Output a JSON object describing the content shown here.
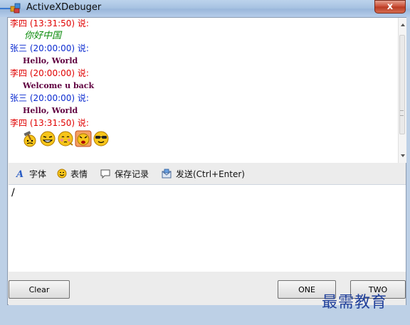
{
  "window": {
    "title": "ActiveXDebuger",
    "close_label": "x"
  },
  "messages": [
    {
      "header": "李四 (13:31:50) 说:",
      "header_color": "red",
      "body": "你好中国",
      "body_style": "green-italic"
    },
    {
      "header": "张三 (20:00:00) 说:",
      "header_color": "blue",
      "body": "Hello, World",
      "body_style": "purple"
    },
    {
      "header": "李四 (20:00:00) 说:",
      "header_color": "red",
      "body": "Welcome u back",
      "body_style": "purple"
    },
    {
      "header": "张三 (20:00:00) 说:",
      "header_color": "blue",
      "body": "Hello, World",
      "body_style": "purple"
    },
    {
      "header": "李四 (13:31:50) 说:",
      "header_color": "red",
      "emojis": [
        "hammer-emoji-icon",
        "grin-emoji-icon",
        "shy-emoji-icon",
        "angry-emoji-icon",
        "cool-emoji-icon"
      ]
    }
  ],
  "toolbar": {
    "font_label": "字体",
    "emoji_label": "表情",
    "history_label": "保存记录",
    "send_label": "发送(Ctrl+Enter)"
  },
  "editor": {
    "value": "/"
  },
  "buttons": {
    "clear": "Clear",
    "one": "ONE",
    "two": "TWO"
  },
  "watermark": "最需教育",
  "colors": {
    "red": "#e00000",
    "blue": "#0a2ad0",
    "green": "#0a8a0a",
    "purple": "#600040"
  }
}
